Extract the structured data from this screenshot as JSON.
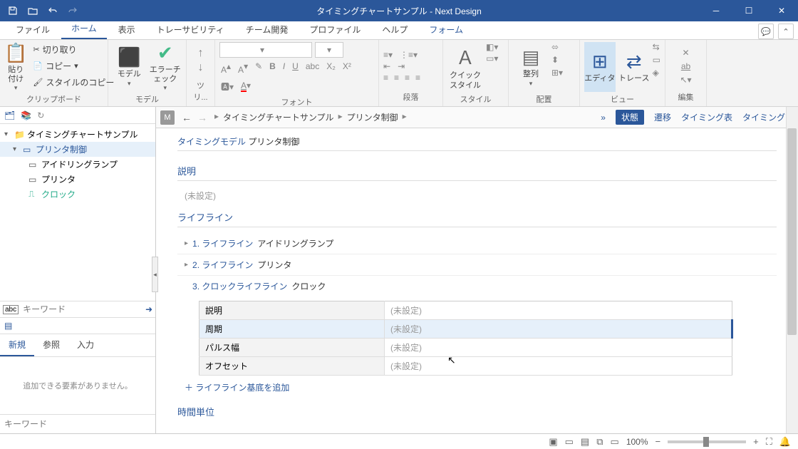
{
  "title": "タイミングチャートサンプル - Next Design",
  "menu": {
    "file": "ファイル",
    "home": "ホーム",
    "view": "表示",
    "trace": "トレーサビリティ",
    "team": "チーム開発",
    "profile": "プロファイル",
    "help": "ヘルプ",
    "form": "フォーム"
  },
  "ribbon": {
    "clipboard": {
      "paste": "貼り付け",
      "cut": "切り取り",
      "copy": "コピー",
      "style": "スタイルのコピー",
      "label": "クリップボード"
    },
    "model": {
      "main": "モデル",
      "err": "エラーチェック",
      "label": "モデル"
    },
    "tree": {
      "label": "ツリ..."
    },
    "font": {
      "label": "フォント",
      "fontname": "",
      "fontsize": ""
    },
    "para": {
      "label": "段落"
    },
    "style": {
      "main": "クイック\nスタイル",
      "label": "スタイル"
    },
    "layout": {
      "main": "整列",
      "label": "配置"
    },
    "vw": {
      "editor": "エディタ",
      "trace": "トレース",
      "label": "ビュー"
    },
    "edit": {
      "label": "編集"
    }
  },
  "tree": {
    "root": "タイミングチャートサンプル",
    "n1": "プリンタ制御",
    "n2": "アイドリングランプ",
    "n3": "プリンタ",
    "n4": "クロック"
  },
  "search": {
    "ph": "キーワード"
  },
  "addtabs": {
    "new": "新規",
    "ref": "参照",
    "in": "入力"
  },
  "addempty": "追加できる要素がありません。",
  "kw": {
    "ph": "キーワード"
  },
  "crumb": {
    "a": "タイミングチャートサンプル",
    "b": "プリンタ制御"
  },
  "vt": {
    "status": "状態",
    "trans": "遷移",
    "ttable": "タイミング表",
    "tchart": "タイミング図"
  },
  "doc": {
    "titleBlue": "タイミングモデル",
    "titleRest": " プリンタ制御",
    "desc": "説明",
    "unset": "(未設定)",
    "lifeline": "ライフライン",
    "lf1a": "1. ライフライン",
    "lf1b": "アイドリングランプ",
    "lf2a": "2. ライフライン",
    "lf2b": "プリンタ",
    "lf3a": "3. クロックライフライン",
    "lf3b": "クロック",
    "p1": "説明",
    "p2": "周期",
    "p3": "パルス幅",
    "p4": "オフセット",
    "pv": "(未設定)",
    "add": "＋ ライフライン基底を追加",
    "timeunit": "時間単位"
  },
  "status": {
    "zoom": "100%"
  }
}
